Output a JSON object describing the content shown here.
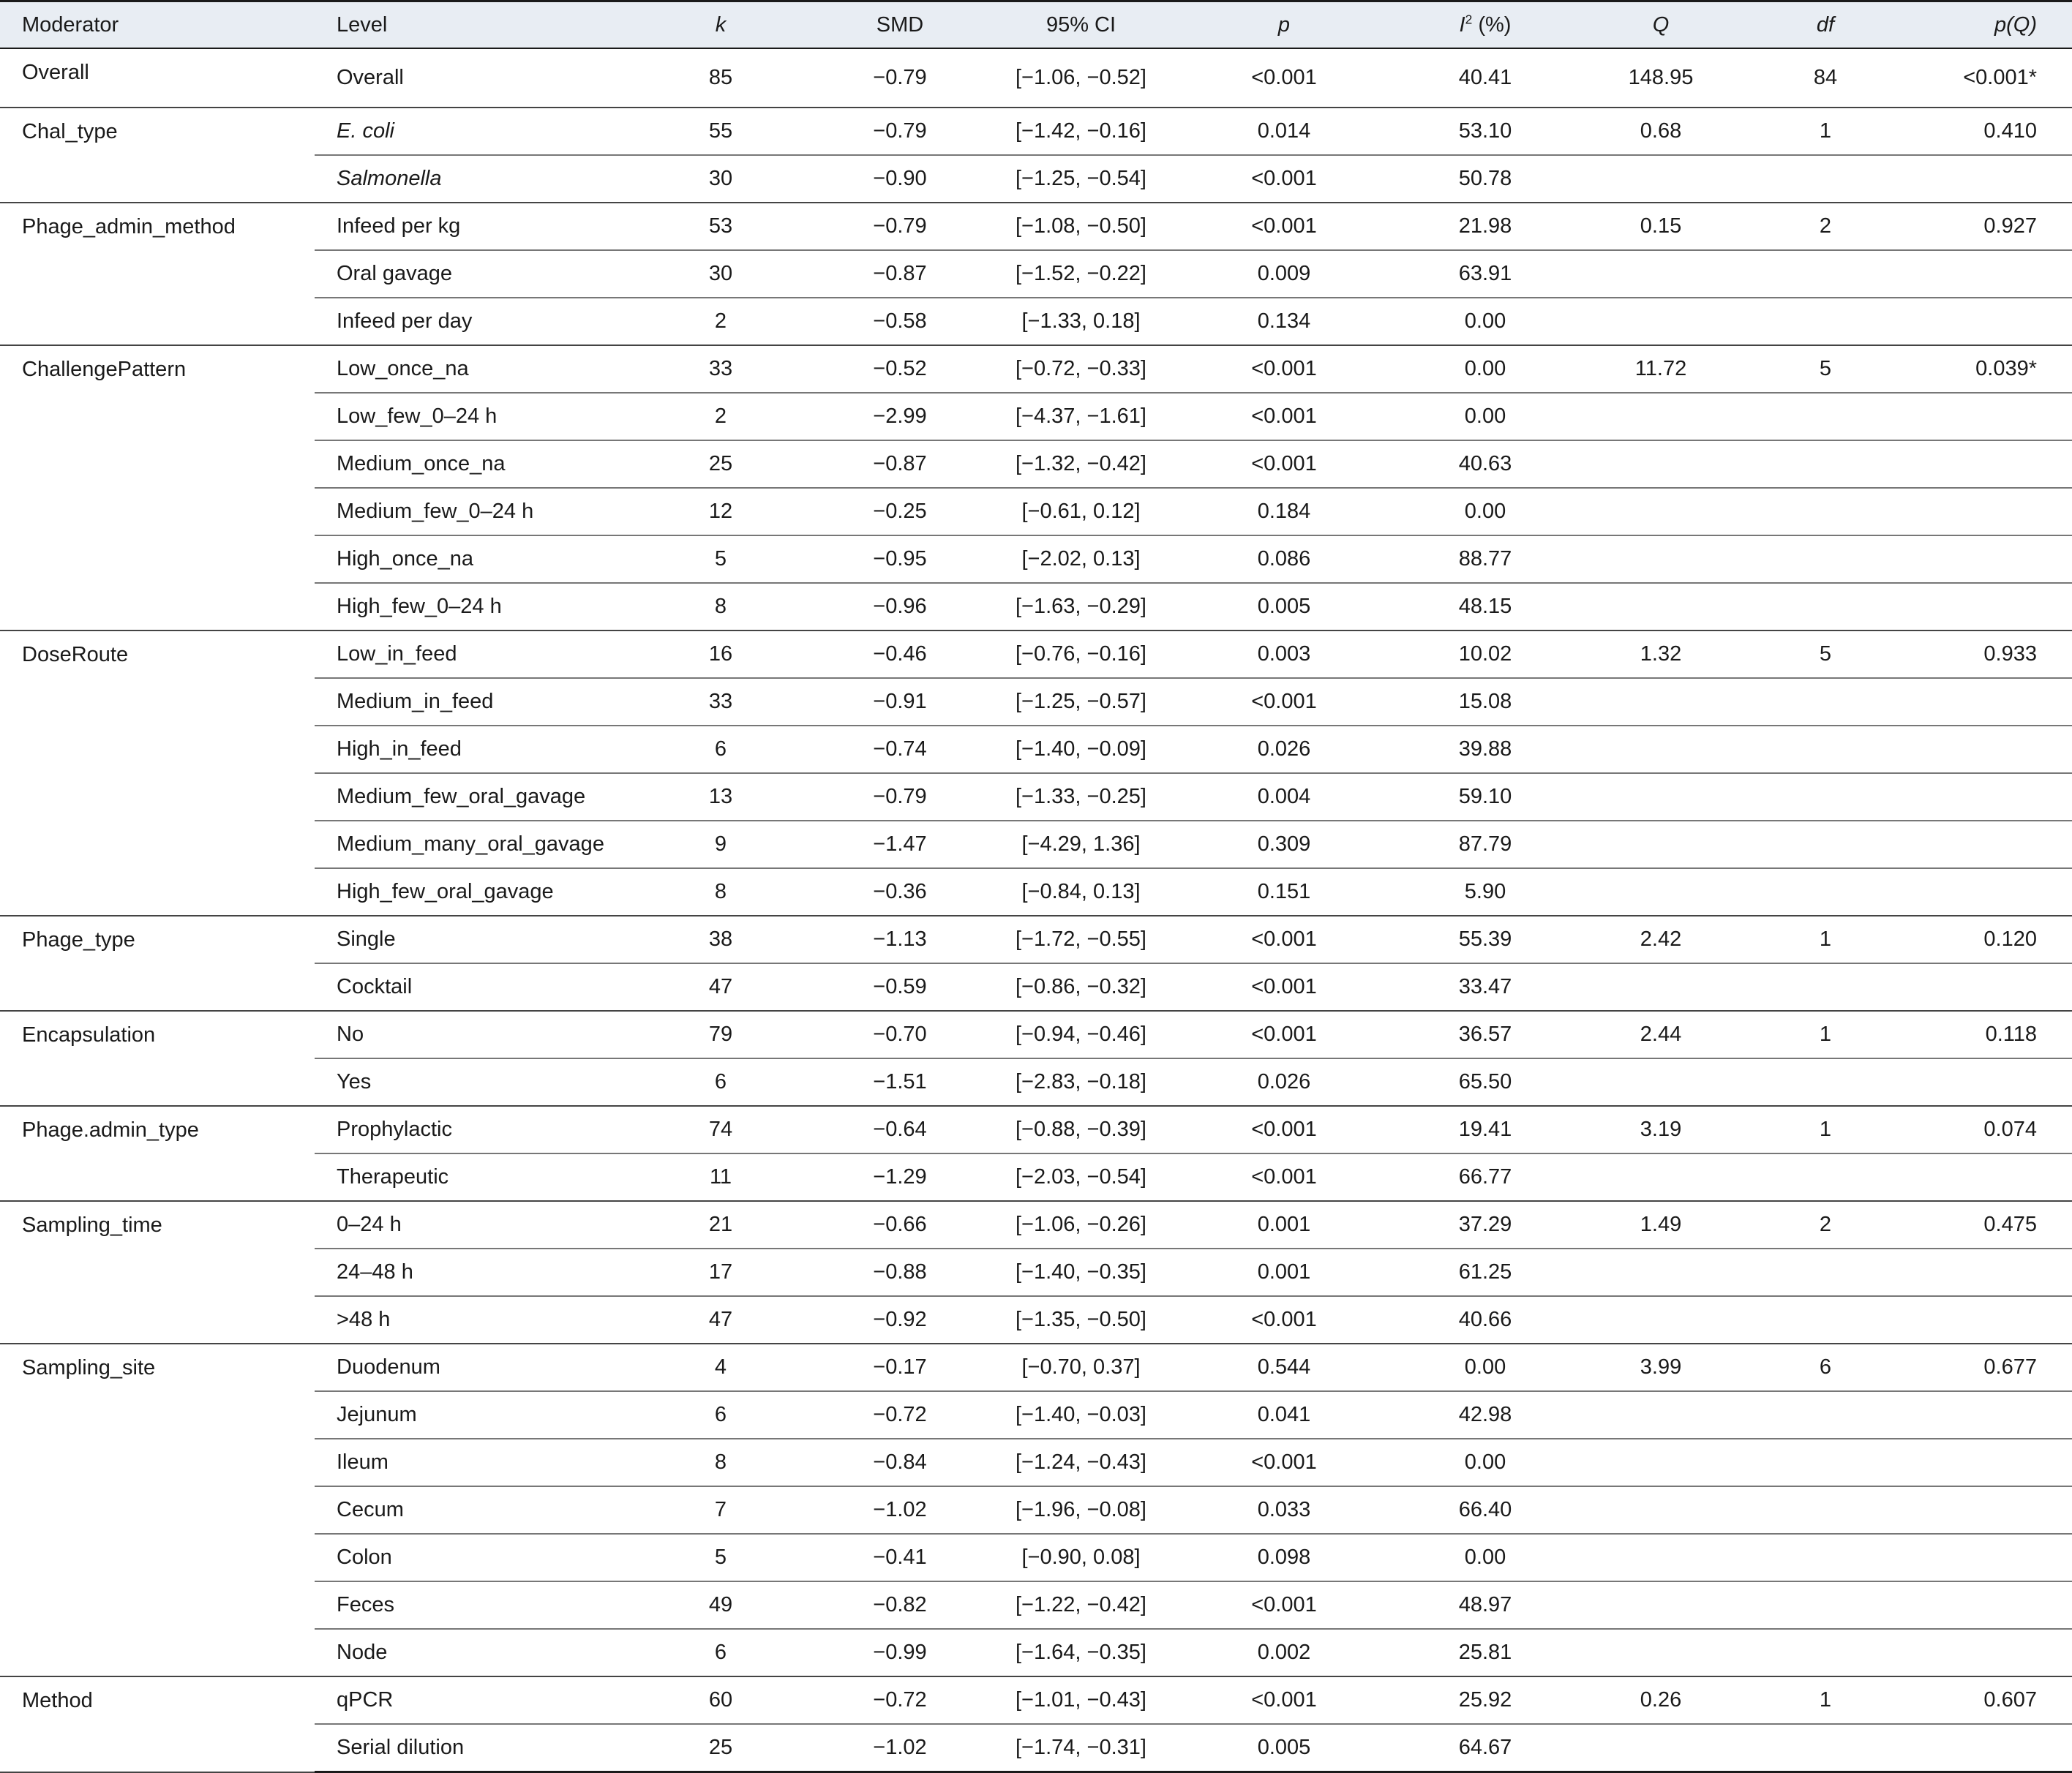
{
  "header": {
    "moderator": "Moderator",
    "level": "Level",
    "k": "k",
    "smd": "SMD",
    "ci": "95% CI",
    "p": "p",
    "i2": "I",
    "i2_sup": "2",
    "i2_unit": " (%)",
    "q": "Q",
    "df": "df",
    "pq": "p(Q)"
  },
  "groups": [
    {
      "moderator": "Overall",
      "q": "148.95",
      "df": "84",
      "pq": "<0.001*",
      "rows": [
        {
          "level": "Overall",
          "k": "85",
          "smd": "−0.79",
          "ci": "[−1.06, −0.52]",
          "p": "<0.001",
          "i2": "40.41"
        }
      ]
    },
    {
      "moderator": "Chal_type",
      "q": "0.68",
      "df": "1",
      "pq": "0.410",
      "rows": [
        {
          "level": "E. coli",
          "italic": true,
          "k": "55",
          "smd": "−0.79",
          "ci": "[−1.42, −0.16]",
          "p": "0.014",
          "i2": "53.10"
        },
        {
          "level": "Salmonella",
          "italic": true,
          "k": "30",
          "smd": "−0.90",
          "ci": "[−1.25, −0.54]",
          "p": "<0.001",
          "i2": "50.78"
        }
      ]
    },
    {
      "moderator": "Phage_admin_method",
      "q": "0.15",
      "df": "2",
      "pq": "0.927",
      "rows": [
        {
          "level": "Infeed per kg",
          "k": "53",
          "smd": "−0.79",
          "ci": "[−1.08, −0.50]",
          "p": "<0.001",
          "i2": "21.98"
        },
        {
          "level": "Oral gavage",
          "k": "30",
          "smd": "−0.87",
          "ci": "[−1.52, −0.22]",
          "p": "0.009",
          "i2": "63.91"
        },
        {
          "level": "Infeed per day",
          "k": "2",
          "smd": "−0.58",
          "ci": "[−1.33, 0.18]",
          "p": "0.134",
          "i2": "0.00"
        }
      ]
    },
    {
      "moderator": "ChallengePattern",
      "q": "11.72",
      "df": "5",
      "pq": "0.039*",
      "rows": [
        {
          "level": "Low_once_na",
          "k": "33",
          "smd": "−0.52",
          "ci": "[−0.72, −0.33]",
          "p": "<0.001",
          "i2": "0.00"
        },
        {
          "level": "Low_few_0–24 h",
          "k": "2",
          "smd": "−2.99",
          "ci": "[−4.37, −1.61]",
          "p": "<0.001",
          "i2": "0.00"
        },
        {
          "level": "Medium_once_na",
          "k": "25",
          "smd": "−0.87",
          "ci": "[−1.32, −0.42]",
          "p": "<0.001",
          "i2": "40.63"
        },
        {
          "level": "Medium_few_0–24 h",
          "k": "12",
          "smd": "−0.25",
          "ci": "[−0.61, 0.12]",
          "p": "0.184",
          "i2": "0.00"
        },
        {
          "level": "High_once_na",
          "k": "5",
          "smd": "−0.95",
          "ci": "[−2.02, 0.13]",
          "p": "0.086",
          "i2": "88.77"
        },
        {
          "level": "High_few_0–24 h",
          "k": "8",
          "smd": "−0.96",
          "ci": "[−1.63, −0.29]",
          "p": "0.005",
          "i2": "48.15"
        }
      ]
    },
    {
      "moderator": "DoseRoute",
      "q": "1.32",
      "df": "5",
      "pq": "0.933",
      "rows": [
        {
          "level": "Low_in_feed",
          "k": "16",
          "smd": "−0.46",
          "ci": "[−0.76, −0.16]",
          "p": "0.003",
          "i2": "10.02"
        },
        {
          "level": "Medium_in_feed",
          "k": "33",
          "smd": "−0.91",
          "ci": "[−1.25, −0.57]",
          "p": "<0.001",
          "i2": "15.08"
        },
        {
          "level": "High_in_feed",
          "k": "6",
          "smd": "−0.74",
          "ci": "[−1.40, −0.09]",
          "p": "0.026",
          "i2": "39.88"
        },
        {
          "level": "Medium_few_oral_gavage",
          "k": "13",
          "smd": "−0.79",
          "ci": "[−1.33, −0.25]",
          "p": "0.004",
          "i2": "59.10"
        },
        {
          "level": "Medium_many_oral_gavage",
          "k": "9",
          "smd": "−1.47",
          "ci": "[−4.29, 1.36]",
          "p": "0.309",
          "i2": "87.79"
        },
        {
          "level": "High_few_oral_gavage",
          "k": "8",
          "smd": "−0.36",
          "ci": "[−0.84, 0.13]",
          "p": "0.151",
          "i2": "5.90"
        }
      ]
    },
    {
      "moderator": "Phage_type",
      "q": "2.42",
      "df": "1",
      "pq": "0.120",
      "rows": [
        {
          "level": "Single",
          "k": "38",
          "smd": "−1.13",
          "ci": "[−1.72, −0.55]",
          "p": "<0.001",
          "i2": "55.39"
        },
        {
          "level": "Cocktail",
          "k": "47",
          "smd": "−0.59",
          "ci": "[−0.86, −0.32]",
          "p": "<0.001",
          "i2": "33.47"
        }
      ]
    },
    {
      "moderator": "Encapsulation",
      "q": "2.44",
      "df": "1",
      "pq": "0.118",
      "rows": [
        {
          "level": "No",
          "k": "79",
          "smd": "−0.70",
          "ci": "[−0.94, −0.46]",
          "p": "<0.001",
          "i2": "36.57"
        },
        {
          "level": "Yes",
          "k": "6",
          "smd": "−1.51",
          "ci": "[−2.83, −0.18]",
          "p": "0.026",
          "i2": "65.50"
        }
      ]
    },
    {
      "moderator": "Phage.admin_type",
      "q": "3.19",
      "df": "1",
      "pq": "0.074",
      "rows": [
        {
          "level": "Prophylactic",
          "k": "74",
          "smd": "−0.64",
          "ci": "[−0.88, −0.39]",
          "p": "<0.001",
          "i2": "19.41"
        },
        {
          "level": "Therapeutic",
          "k": "11",
          "smd": "−1.29",
          "ci": "[−2.03, −0.54]",
          "p": "<0.001",
          "i2": "66.77"
        }
      ]
    },
    {
      "moderator": "Sampling_time",
      "q": "1.49",
      "df": "2",
      "pq": "0.475",
      "rows": [
        {
          "level": "0–24 h",
          "k": "21",
          "smd": "−0.66",
          "ci": "[−1.06, −0.26]",
          "p": "0.001",
          "i2": "37.29"
        },
        {
          "level": "24–48 h",
          "k": "17",
          "smd": "−0.88",
          "ci": "[−1.40, −0.35]",
          "p": "0.001",
          "i2": "61.25"
        },
        {
          "level": ">48 h",
          "k": "47",
          "smd": "−0.92",
          "ci": "[−1.35, −0.50]",
          "p": "<0.001",
          "i2": "40.66"
        }
      ]
    },
    {
      "moderator": "Sampling_site",
      "q": "3.99",
      "df": "6",
      "pq": "0.677",
      "rows": [
        {
          "level": "Duodenum",
          "k": "4",
          "smd": "−0.17",
          "ci": "[−0.70, 0.37]",
          "p": "0.544",
          "i2": "0.00"
        },
        {
          "level": "Jejunum",
          "k": "6",
          "smd": "−0.72",
          "ci": "[−1.40, −0.03]",
          "p": "0.041",
          "i2": "42.98"
        },
        {
          "level": "Ileum",
          "k": "8",
          "smd": "−0.84",
          "ci": "[−1.24, −0.43]",
          "p": "<0.001",
          "i2": "0.00"
        },
        {
          "level": "Cecum",
          "k": "7",
          "smd": "−1.02",
          "ci": "[−1.96, −0.08]",
          "p": "0.033",
          "i2": "66.40"
        },
        {
          "level": "Colon",
          "k": "5",
          "smd": "−0.41",
          "ci": "[−0.90, 0.08]",
          "p": "0.098",
          "i2": "0.00"
        },
        {
          "level": "Feces",
          "k": "49",
          "smd": "−0.82",
          "ci": "[−1.22, −0.42]",
          "p": "<0.001",
          "i2": "48.97"
        },
        {
          "level": "Node",
          "k": "6",
          "smd": "−0.99",
          "ci": "[−1.64, −0.35]",
          "p": "0.002",
          "i2": "25.81"
        }
      ]
    },
    {
      "moderator": "Method",
      "q": "0.26",
      "df": "1",
      "pq": "0.607",
      "rows": [
        {
          "level": "qPCR",
          "k": "60",
          "smd": "−0.72",
          "ci": "[−1.01, −0.43]",
          "p": "<0.001",
          "i2": "25.92"
        },
        {
          "level": "Serial dilution",
          "k": "25",
          "smd": "−1.02",
          "ci": "[−1.74, −0.31]",
          "p": "0.005",
          "i2": "64.67"
        }
      ]
    }
  ]
}
